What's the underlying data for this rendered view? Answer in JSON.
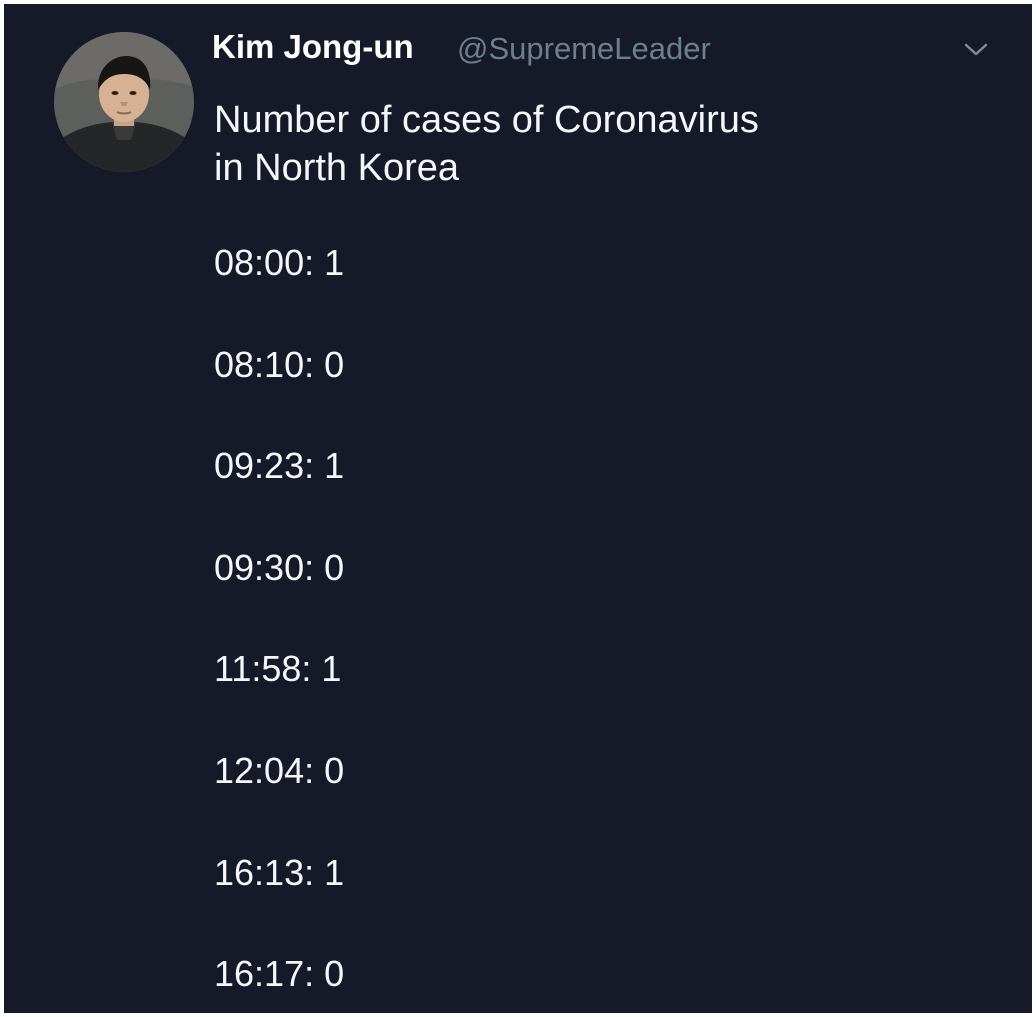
{
  "tweet": {
    "author": {
      "name": "Kim Jong-un",
      "handle": "@SupremeLeader",
      "avatar_icon": "profile-photo"
    },
    "menu_icon": "chevron-down-icon",
    "text_lines": [
      "Number of cases of Coronavirus",
      "in North Korea"
    ],
    "entries": [
      "08:00: 1",
      "08:10: 0",
      "09:23: 1",
      "09:30: 0",
      "11:58: 1",
      "12:04: 0",
      "16:13: 1",
      "16:17: 0"
    ],
    "colors": {
      "background": "#161a28",
      "text": "#f5f7fb",
      "handle": "#6d7f8f"
    }
  }
}
